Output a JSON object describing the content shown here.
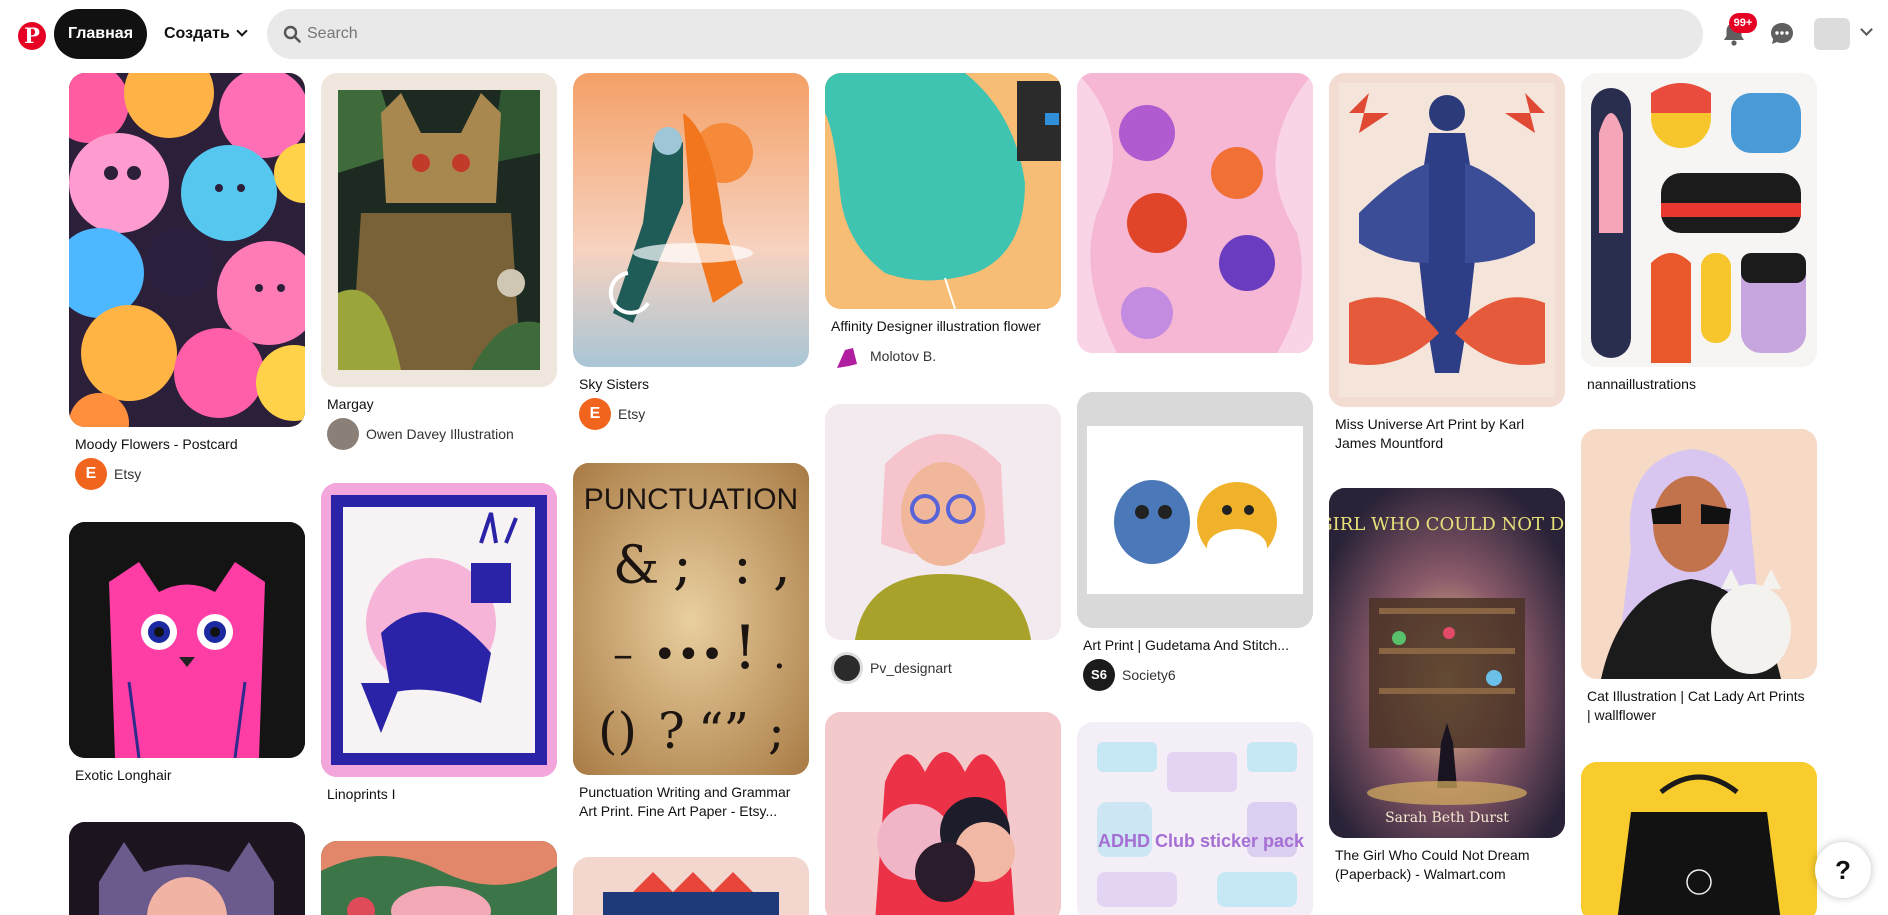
{
  "header": {
    "home_label": "Главная",
    "create_label": "Создать",
    "search_placeholder": "Search",
    "notifications_badge": "99+"
  },
  "pins": [
    {
      "title": "Moody Flowers - Postcard",
      "source": "Etsy",
      "source_initial": "E"
    },
    {
      "title": "Exotic Longhair"
    },
    {
      "title": "Margay",
      "source": "Owen Davey Illustration"
    },
    {
      "title": "Linoprints I"
    },
    {
      "title": "Sky Sisters",
      "source": "Etsy",
      "source_initial": "E"
    },
    {
      "title": "Punctuation Writing and Grammar Art Print. Fine Art Paper - Etsy...",
      "image_text": "PUNCTUATION"
    },
    {
      "title": "Affinity Designer illustration flower",
      "source": "Molotov B."
    },
    {
      "title": "",
      "source": "Pv_designart"
    },
    {
      "title": "Art Print | Gudetama And Stitch...",
      "source": "Society6",
      "source_initial": "S6"
    },
    {
      "title": "",
      "image_text": "ADHD Club sticker pack"
    },
    {
      "title": "Miss Universe Art Print by Karl James Mountford"
    },
    {
      "title": "The Girl Who Could Not Dream (Paperback) - Walmart.com",
      "image_text": "THE GIRL WHO COULD NOT DREAM",
      "image_subtext": "Sarah Beth Durst"
    },
    {
      "title": "nannaillustrations"
    },
    {
      "title": "Cat Illustration | Cat Lady Art Prints | wallflower"
    }
  ],
  "help_label": "?",
  "colors": {
    "brand": "#e60023",
    "search_bg": "#e9e9e9"
  }
}
